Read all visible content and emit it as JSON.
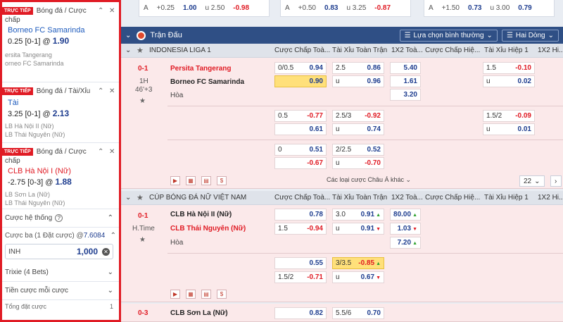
{
  "slip": {
    "items": [
      {
        "live": "TRỰC TIẾP",
        "category": "Bóng đá / Cược",
        "category2": "chấp",
        "pick": "Borneo FC Samarinda",
        "line": "0.25 [0-1] @",
        "odds": "1.90",
        "team1": "ersita Tangerang",
        "team2": "orneo FC Samarinda"
      },
      {
        "live": "TRỰC TIẾP",
        "category": "Bóng đá / Tài/Xỉu",
        "category2": "",
        "pick": "Tài",
        "line": "3.25 [0-1] @",
        "odds": "2.13",
        "team1": "LB Hà Nội II (Nữ)",
        "team2": "LB Thái Nguyên (Nữ)"
      },
      {
        "live": "TRỰC TIẾP",
        "category": "Bóng đá / Cược",
        "category2": "chấp",
        "pick": "CLB Hà Nội I (Nữ)",
        "line": "-2.75 [0-3] @",
        "odds": "1.88",
        "team1": "LB Sơn La (Nữ)",
        "team2": "LB Thái Nguyên (Nữ)"
      }
    ],
    "system_label": "Cược hệ thống",
    "stake_label_prefix": "Cược ba (1 Đặt cược) @",
    "stake_label_odds": "7.6084",
    "currency": "INH",
    "amount": "1,000",
    "trixie_label": "Trixie (4 Bets)",
    "per_bet_label": "Tiền cược mỗi cược",
    "total_label": "Tổng đặt cược",
    "total_value": "1"
  },
  "top_strip": [
    {
      "a": "A",
      "handicap": "+0.25",
      "h_odds": "1.00",
      "ou": "u 2.50",
      "ou_odds": "-0.98"
    },
    {
      "a": "A",
      "handicap": "+0.50",
      "h_odds": "0.83",
      "ou": "u 3.25",
      "ou_odds": "-0.87"
    },
    {
      "a": "A",
      "handicap": "+1.50",
      "h_odds": "0.73",
      "ou": "u 3.00",
      "ou_odds": "0.79"
    }
  ],
  "header": {
    "title": "Trận Đấu",
    "sort_label": "Lựa chọn bình thường",
    "odds_type": "Hai Dòng"
  },
  "columns": {
    "handicap_ft": "Cược Chấp Toà...",
    "ou_ft": "Tài Xỉu Toàn Trận",
    "x12": "1X2 Toà...",
    "handicap_h1": "Cược Chấp Hiệ...",
    "ou_h1": "Tài Xỉu Hiệp 1",
    "x12_h1": "1X2 Hi..."
  },
  "league1": {
    "name": "INDONESIA LIGA 1",
    "score": "0-1",
    "period": "1H",
    "minute": "46'+3",
    "home": "Persita Tangerang",
    "away": "Borneo FC Samarinda",
    "draw": "Hòa",
    "rows": [
      {
        "h_line": "0/0.5",
        "h_home": "0.94",
        "h_away": "0.90",
        "ou_line": "2.5",
        "ou_over": "0.86",
        "ou_u": "u",
        "ou_under": "0.96",
        "x1": "5.40",
        "x2": "1.61",
        "xd": "3.20",
        "h1_line": "",
        "ou1_line": "1.5",
        "ou1_over": "-0.10",
        "ou1_u": "u",
        "ou1_under": "0.02"
      },
      {
        "h_line": "0.5",
        "h_home": "-0.77",
        "h_away": "0.61",
        "ou_line": "2.5/3",
        "ou_over": "-0.92",
        "ou_u": "u",
        "ou_under": "0.74",
        "ou1_line": "1.5/2",
        "ou1_over": "-0.09",
        "ou1_u": "u",
        "ou1_under": "0.01"
      },
      {
        "h_line": "0",
        "h_home": "0.51",
        "h_away": "-0.67",
        "ou_line": "2/2.5",
        "ou_over": "0.52",
        "ou_u": "u",
        "ou_under": "-0.70"
      }
    ],
    "more_label": "Các loại cược Châu Á khác",
    "page": "22"
  },
  "league2": {
    "name": "CÚP BÓNG ĐÁ NỮ VIỆT NAM",
    "score": "0-1",
    "period": "H.Time",
    "home": "CLB Hà Nội II (Nữ)",
    "away": "CLB Thái Nguyên (Nữ)",
    "draw": "Hòa",
    "rows": [
      {
        "h_line": "1.5",
        "h_home": "0.78",
        "h_away": "-0.94",
        "ou_line": "3.0",
        "ou_over": "0.91",
        "ou_u": "u",
        "ou_under": "0.91",
        "x1": "80.00",
        "x2": "1.03",
        "xd": "7.20"
      },
      {
        "h_line": "1.5/2",
        "h_home": "0.55",
        "h_away": "-0.71",
        "ou_line": "3/3.5",
        "ou_over": "-0.85",
        "ou_u": "u",
        "ou_under": "0.67"
      }
    ]
  },
  "league3": {
    "score": "0-3",
    "home": "CLB Sơn La (Nữ)",
    "h_home": "0.82",
    "ou_line": "5.5/6",
    "ou_over": "0.70"
  }
}
